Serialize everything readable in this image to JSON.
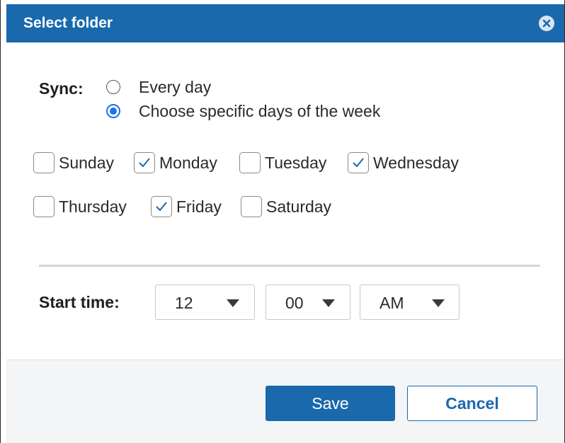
{
  "dialog": {
    "title": "Select folder"
  },
  "sync": {
    "label": "Sync:",
    "options": [
      {
        "label": "Every day",
        "selected": false
      },
      {
        "label": "Choose specific days of the week",
        "selected": true
      }
    ]
  },
  "days": [
    {
      "label": "Sunday",
      "checked": false
    },
    {
      "label": "Monday",
      "checked": true
    },
    {
      "label": "Tuesday",
      "checked": false
    },
    {
      "label": "Wednesday",
      "checked": true
    },
    {
      "label": "Thursday",
      "checked": false
    },
    {
      "label": "Friday",
      "checked": true
    },
    {
      "label": "Saturday",
      "checked": false
    }
  ],
  "start_time": {
    "label": "Start time:",
    "hour": "12",
    "minute": "00",
    "period": "AM"
  },
  "footer": {
    "save_label": "Save",
    "cancel_label": "Cancel"
  },
  "colors": {
    "primary": "#1a69ad",
    "radio_accent": "#1a73e8",
    "footer_bg": "#f3f5f7"
  },
  "icons": {
    "close": "close-icon",
    "checkmark": "checkmark-icon",
    "dropdown": "caret-down-icon"
  }
}
